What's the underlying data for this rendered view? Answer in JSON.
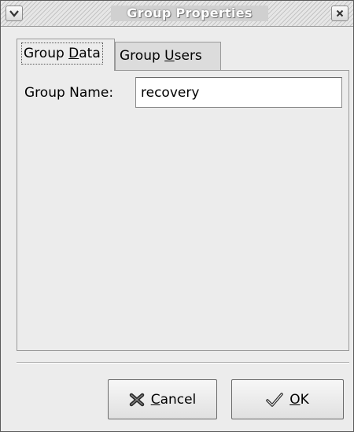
{
  "window": {
    "title": "Group Properties",
    "menu_icon": "chevron-down-icon",
    "close_icon": "close-icon"
  },
  "tabs": [
    {
      "label_prefix": "Group ",
      "mnemonic": "D",
      "label_suffix": "ata",
      "active": true
    },
    {
      "label_prefix": "Group ",
      "mnemonic": "U",
      "label_suffix": "sers",
      "active": false
    }
  ],
  "form": {
    "group_name_label": "Group Name:",
    "group_name_value": "recovery"
  },
  "buttons": {
    "cancel": {
      "mnemonic": "C",
      "label_rest": "ancel",
      "icon": "cancel-x-icon"
    },
    "ok": {
      "mnemonic": "O",
      "label_rest": "K",
      "icon": "checkmark-icon"
    }
  }
}
